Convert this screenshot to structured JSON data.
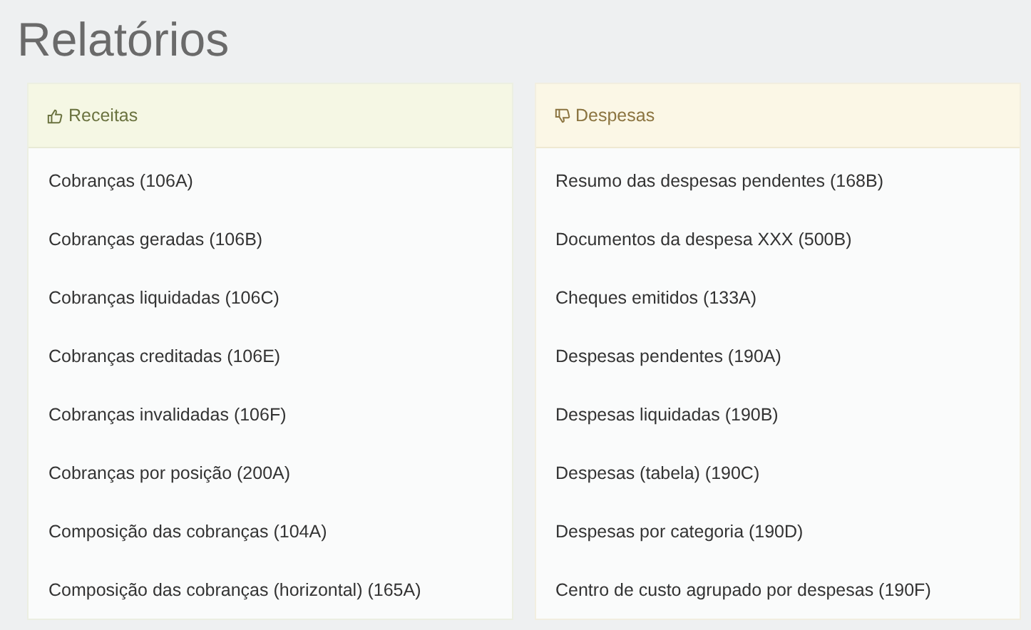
{
  "page_title": "Relatórios",
  "panels": [
    {
      "kind": "income",
      "title": "Receitas",
      "items": [
        "Cobranças (106A)",
        "Cobranças geradas (106B)",
        "Cobranças liquidadas (106C)",
        "Cobranças creditadas (106E)",
        "Cobranças invalidadas (106F)",
        "Cobranças por posição (200A)",
        "Composição das cobranças (104A)",
        "Composição das cobranças (horizontal) (165A)"
      ]
    },
    {
      "kind": "expense",
      "title": "Despesas",
      "items": [
        "Resumo das despesas pendentes (168B)",
        "Documentos da despesa XXX (500B)",
        "Cheques emitidos (133A)",
        "Despesas pendentes (190A)",
        "Despesas liquidadas (190B)",
        "Despesas (tabela) (190C)",
        "Despesas por categoria (190D)",
        "Centro de custo agrupado por despesas (190F)"
      ]
    }
  ]
}
